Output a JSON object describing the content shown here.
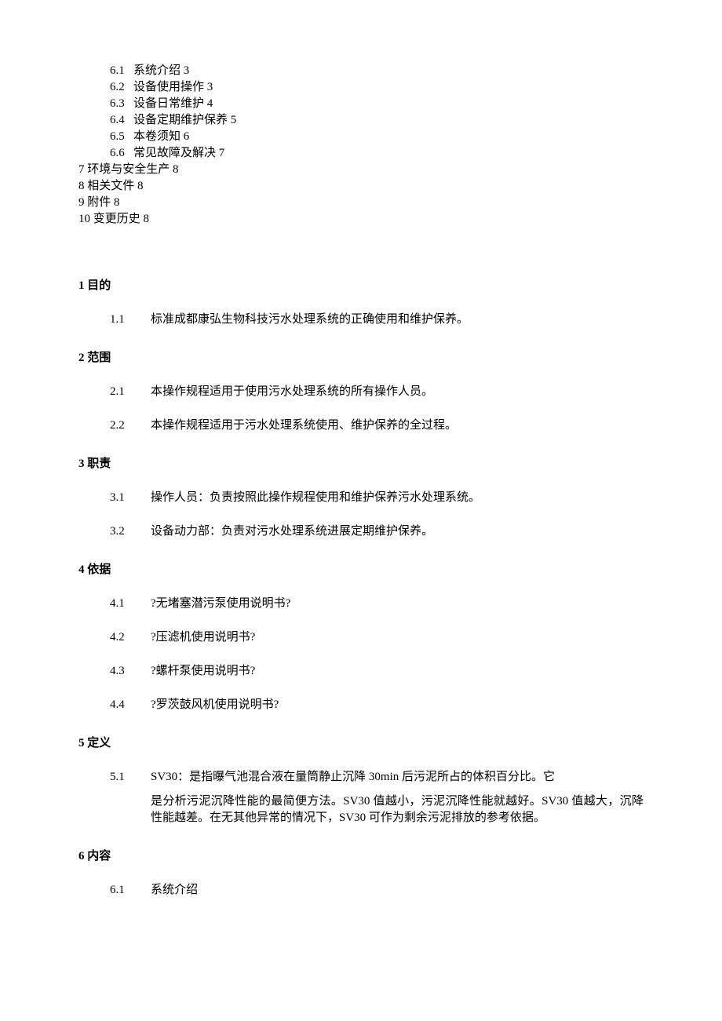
{
  "toc_sub": [
    {
      "num": "6.1",
      "label": "系统介绍 3"
    },
    {
      "num": "6.2",
      "label": "设备使用操作 3"
    },
    {
      "num": "6.3",
      "label": "设备日常维护 4"
    },
    {
      "num": "6.4",
      "label": "设备定期维护保养 5"
    },
    {
      "num": "6.5",
      "label": "本卷须知 6"
    },
    {
      "num": "6.6",
      "label": "常见故障及解决 7"
    }
  ],
  "toc_top": [
    "7 环境与安全生产 8",
    "8 相关文件 8",
    "9 附件 8",
    "10 变更历史 8"
  ],
  "sections": {
    "s1": {
      "heading": "1 目的",
      "items": [
        {
          "num": "1.1",
          "text": "标准成都康弘生物科技污水处理系统的正确使用和维护保养。"
        }
      ]
    },
    "s2": {
      "heading": "2 范围",
      "items": [
        {
          "num": "2.1",
          "text": "本操作规程适用于使用污水处理系统的所有操作人员。"
        },
        {
          "num": "2.2",
          "text": "本操作规程适用于污水处理系统使用、维护保养的全过程。"
        }
      ]
    },
    "s3": {
      "heading": "3 职责",
      "items": [
        {
          "num": "3.1",
          "text": "操作人员：负责按照此操作规程使用和维护保养污水处理系统。"
        },
        {
          "num": "3.2",
          "text": "设备动力部：负责对污水处理系统进展定期维护保养。"
        }
      ]
    },
    "s4": {
      "heading": "4 依据",
      "items": [
        {
          "num": "4.1",
          "text": "?无堵塞潜污泵使用说明书?"
        },
        {
          "num": "4.2",
          "text": "?压滤机使用说明书?"
        },
        {
          "num": "4.3",
          "text": "?螺杆泵使用说明书?"
        },
        {
          "num": "4.4",
          "text": "?罗茨鼓风机使用说明书?"
        }
      ]
    },
    "s5": {
      "heading": "5 定义",
      "items": [
        {
          "num": "5.1",
          "text": "SV30：是指曝气池混合液在量筒静止沉降 30min 后污泥所占的体积百分比。它"
        }
      ],
      "sub": "是分析污泥沉降性能的最简便方法。SV30 值越小，污泥沉降性能就越好。SV30 值越大，沉降性能越差。在无其他异常的情况下，SV30 可作为剩余污泥排放的参考依据。"
    },
    "s6": {
      "heading": "6 内容",
      "items": [
        {
          "num": "6.1",
          "text": "系统介绍"
        }
      ]
    }
  }
}
